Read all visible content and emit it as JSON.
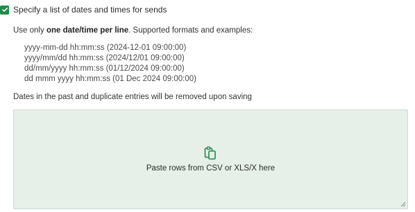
{
  "checkbox": {
    "label": "Specify a list of dates and times for sends",
    "checked": true,
    "color": "#1f8a4c"
  },
  "instructions": {
    "prefix": "Use only ",
    "emphasis": "one date/time per line",
    "suffix": ". Supported formats and examples:"
  },
  "formats": [
    "yyyy-mm-dd hh:mm:ss (2024-12-01 09:00:00)",
    "yyyy/mm/dd hh:mm:ss (2024/12/01 09:00:00)",
    "dd/mm/yyyy hh:mm:ss (01/12/2024 09:00:00)",
    "dd mmm yyyy hh:mm:ss (01 Dec 2024 09:00:00)"
  ],
  "note": "Dates in the past and duplicate entries will be removed upon saving",
  "dropzone": {
    "label": "Paste rows from CSV or XLS/X here",
    "icon": "paste-icon",
    "icon_color": "#1f8a4c",
    "background": "#e6efe8"
  }
}
